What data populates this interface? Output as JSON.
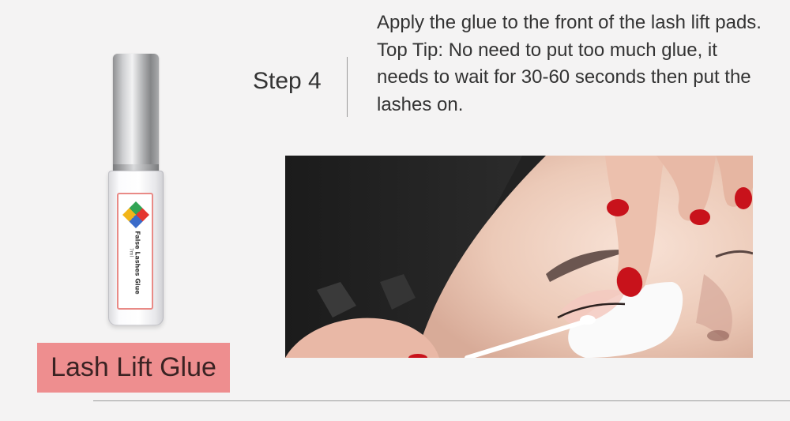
{
  "product": {
    "badge_label": "Lash Lift Glue",
    "bottle_label": "False Lashes Glue",
    "bottle_volume": "7ml",
    "accent_color": "#ee8e8f"
  },
  "step": {
    "title": "Step 4",
    "instruction": "Apply the glue to the front of the lash lift pads.",
    "tip": "Top Tip: No need to put too much glue, it needs to wait for 30-60 seconds then put the lashes on."
  },
  "photo": {
    "subject": "lash-application-photo"
  }
}
